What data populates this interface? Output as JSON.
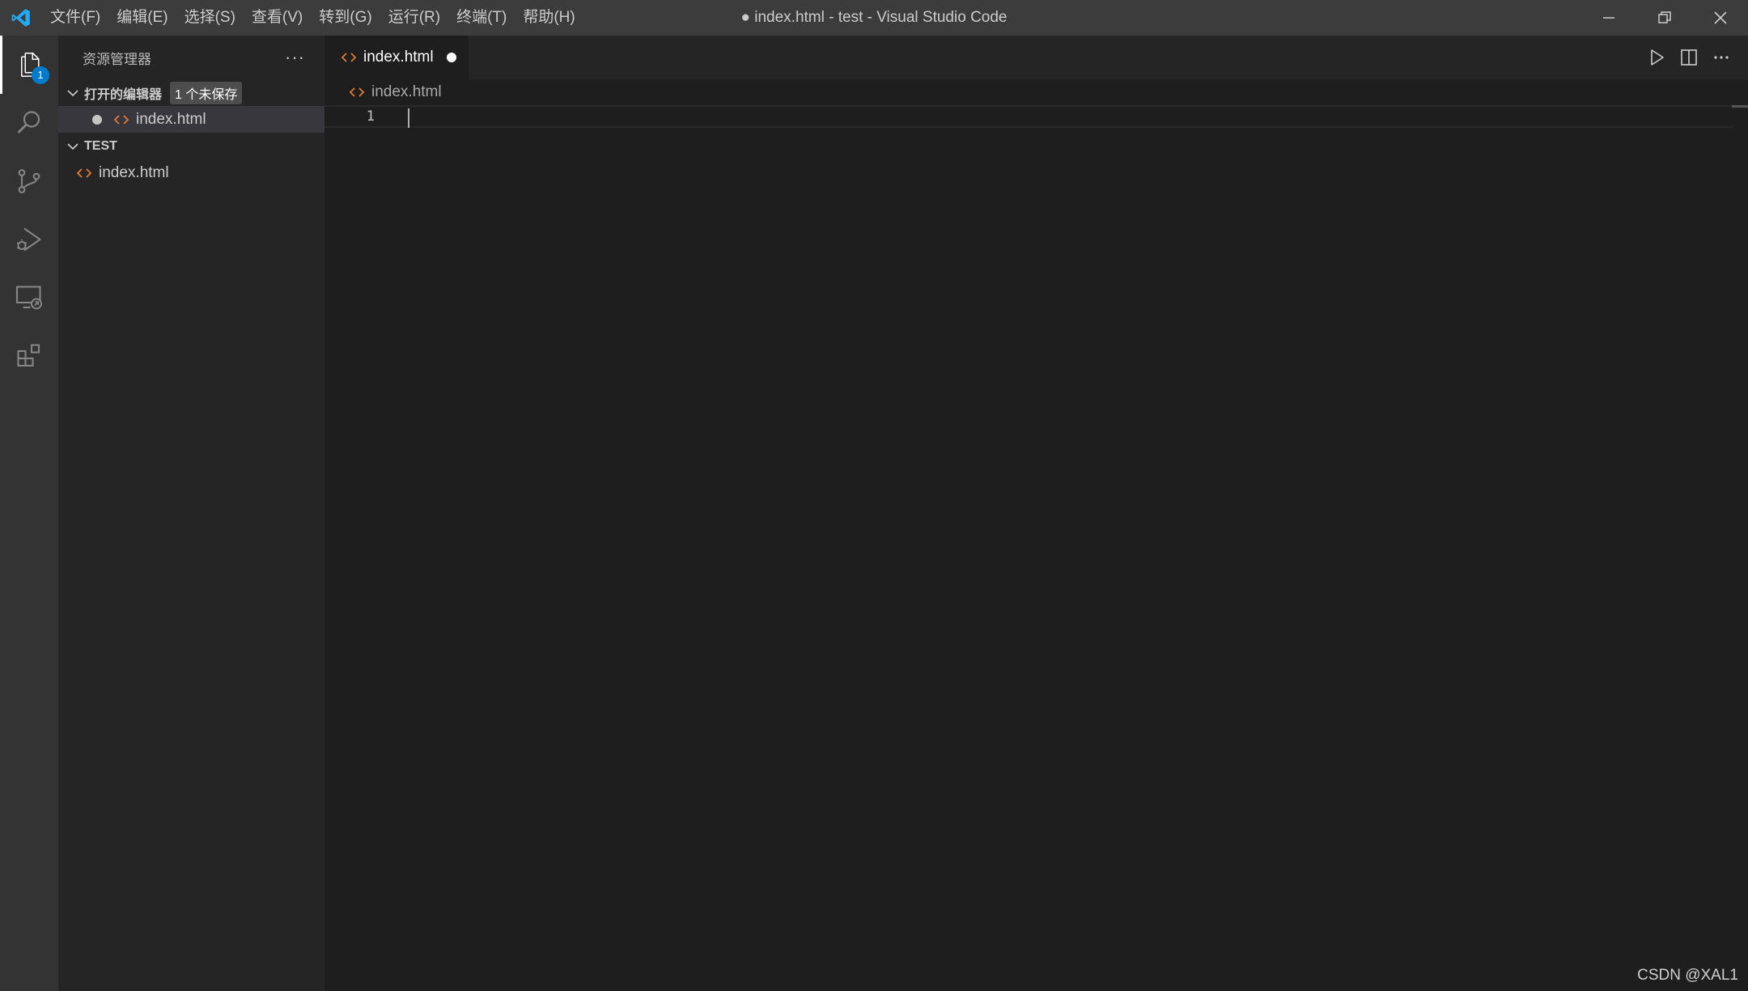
{
  "titlebar": {
    "menu": [
      "文件(F)",
      "编辑(E)",
      "选择(S)",
      "查看(V)",
      "转到(G)",
      "运行(R)",
      "终端(T)",
      "帮助(H)"
    ],
    "window_title": "● index.html - test - Visual Studio Code",
    "controls": [
      "minimize-icon",
      "restore-icon",
      "close-icon"
    ]
  },
  "activitybar": {
    "items": [
      {
        "icon": "explorer-icon",
        "badge": "1"
      },
      {
        "icon": "search-icon"
      },
      {
        "icon": "source-control-icon"
      },
      {
        "icon": "run-debug-icon"
      },
      {
        "icon": "remote-explorer-icon"
      },
      {
        "icon": "extensions-icon"
      }
    ]
  },
  "sidebar": {
    "title": "资源管理器",
    "more": "···",
    "open_editors": {
      "label": "打开的编辑器",
      "badge": "1 个未保存",
      "items": [
        {
          "name": "index.html",
          "dirty": true
        }
      ]
    },
    "folder": {
      "label": "TEST",
      "items": [
        {
          "name": "index.html"
        }
      ]
    }
  },
  "editor": {
    "tab": {
      "label": "index.html",
      "dirty": true
    },
    "actions": [
      "run-icon",
      "split-editor-icon",
      "more-actions-icon"
    ],
    "breadcrumb": "index.html",
    "lines": [
      {
        "number": "1",
        "text": ""
      }
    ]
  },
  "watermark": "CSDN @XAL1",
  "colors": {
    "accent": "#007acc",
    "html_icon": "#e37933",
    "titlebar": "#3c3c3c",
    "activitybar": "#333333",
    "sidebar": "#252526",
    "editor": "#1e1e1e"
  }
}
